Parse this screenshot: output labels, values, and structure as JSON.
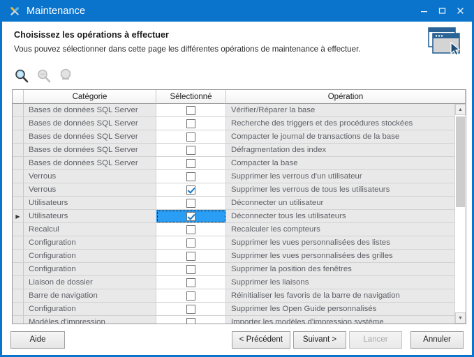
{
  "window": {
    "title": "Maintenance",
    "icon": "tools-icon",
    "controls": {
      "minimize": "–",
      "maximize": "☐",
      "close": "✕"
    },
    "accent_color": "#0a74cd"
  },
  "banner": {
    "heading": "Choisissez les opérations à effectuer",
    "subheading": "Vous pouvez sélectionner dans cette page les différentes opérations de maintenance à effectuer.",
    "icon": "windows-cursor-icon"
  },
  "toolbar": {
    "items": [
      {
        "name": "search-icon",
        "enabled": true
      },
      {
        "name": "zoom-out-icon",
        "enabled": false
      },
      {
        "name": "zoom-in-icon",
        "enabled": false
      }
    ]
  },
  "grid": {
    "columns": [
      "Catégorie",
      "Sélectionné",
      "Opération"
    ],
    "row_indicator_glyph": "▶",
    "selected_row_index": 8,
    "rows": [
      {
        "categorie": "Bases de données SQL Server",
        "selectionne": false,
        "operation": "Vérifier/Réparer la base"
      },
      {
        "categorie": "Bases de données SQL Server",
        "selectionne": false,
        "operation": "Recherche des triggers et des procédures stockées"
      },
      {
        "categorie": "Bases de données SQL Server",
        "selectionne": false,
        "operation": "Compacter le journal de transactions de la base"
      },
      {
        "categorie": "Bases de données SQL Server",
        "selectionne": false,
        "operation": "Défragmentation des index"
      },
      {
        "categorie": "Bases de données SQL Server",
        "selectionne": false,
        "operation": "Compacter la base"
      },
      {
        "categorie": "Verrous",
        "selectionne": false,
        "operation": "Supprimer les verrous d'un utilisateur"
      },
      {
        "categorie": "Verrous",
        "selectionne": true,
        "operation": "Supprimer les verrous de tous les utilisateurs"
      },
      {
        "categorie": "Utilisateurs",
        "selectionne": false,
        "operation": "Déconnecter un utilisateur"
      },
      {
        "categorie": "Utilisateurs",
        "selectionne": true,
        "operation": "Déconnecter tous les utilisateurs"
      },
      {
        "categorie": "Recalcul",
        "selectionne": false,
        "operation": "Recalculer les compteurs"
      },
      {
        "categorie": "Configuration",
        "selectionne": false,
        "operation": "Supprimer les vues personnalisées des listes"
      },
      {
        "categorie": "Configuration",
        "selectionne": false,
        "operation": "Supprimer les vues personnalisées des grilles"
      },
      {
        "categorie": "Configuration",
        "selectionne": false,
        "operation": "Supprimer la position des fenêtres"
      },
      {
        "categorie": "Liaison de dossier",
        "selectionne": false,
        "operation": "Supprimer les liaisons"
      },
      {
        "categorie": "Barre de navigation",
        "selectionne": false,
        "operation": "Réinitialiser les favoris de la barre de navigation"
      },
      {
        "categorie": "Configuration",
        "selectionne": false,
        "operation": "Supprimer les Open Guide personnalisés"
      },
      {
        "categorie": "Modèles d'impression",
        "selectionne": false,
        "operation": "Importer les modèles d'impression système"
      }
    ],
    "scrollbar": {
      "up_glyph": "▲",
      "down_glyph": "▼"
    }
  },
  "buttons": {
    "aide": "Aide",
    "precedent": "< Précédent",
    "suivant": "Suivant >",
    "lancer": "Lancer",
    "lancer_enabled": false,
    "annuler": "Annuler"
  }
}
